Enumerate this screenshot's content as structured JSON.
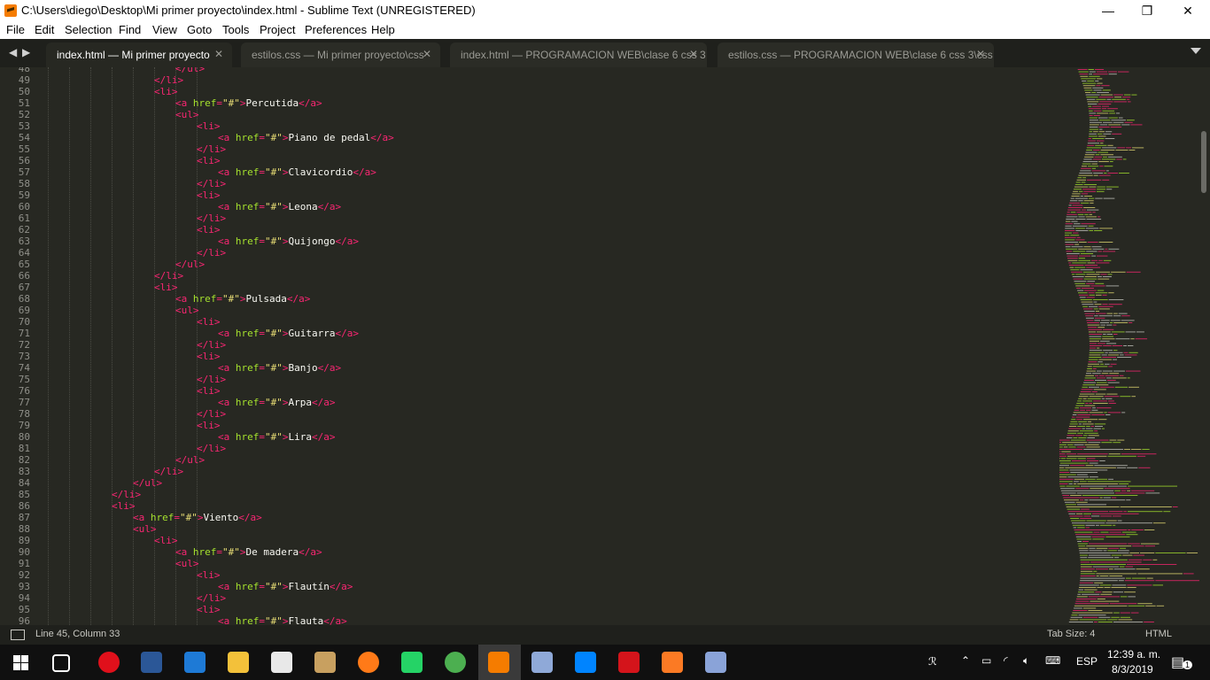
{
  "window": {
    "title": "C:\\Users\\diego\\Desktop\\Mi primer proyecto\\index.html - Sublime Text (UNREGISTERED)",
    "minimize": "—",
    "maximize": "❐",
    "close": "✕"
  },
  "menu": [
    "File",
    "Edit",
    "Selection",
    "Find",
    "View",
    "Goto",
    "Tools",
    "Project",
    "Preferences",
    "Help"
  ],
  "tabs": [
    {
      "label": "index.html — Mi primer proyecto",
      "active": true
    },
    {
      "label": "estilos.css — Mi primer proyecto\\css",
      "active": false
    },
    {
      "label": "index.html — PROGRAMACION  WEB\\clase 6 css 3",
      "active": false
    },
    {
      "label": "estilos.css — PROGRAMACION  WEB\\clase 6 css 3\\css",
      "active": false
    }
  ],
  "tab_close": "✕",
  "nav": {
    "back": "◀",
    "forward": "▶"
  },
  "editor": {
    "lines": [
      {
        "n": 48,
        "i": 6,
        "t": [
          [
            "tag",
            "</ul>"
          ]
        ]
      },
      {
        "n": 49,
        "i": 5,
        "t": [
          [
            "tag",
            "</li>"
          ]
        ]
      },
      {
        "n": 50,
        "i": 5,
        "t": [
          [
            "tag",
            "<li>"
          ]
        ]
      },
      {
        "n": 51,
        "i": 6,
        "t": [
          [
            "tag",
            "<a "
          ],
          [
            "attr",
            "href"
          ],
          [
            "tag",
            "="
          ],
          [
            "str",
            "\"#\""
          ],
          [
            "tag",
            ">"
          ],
          [
            "txt",
            "Percutida"
          ],
          [
            "tag",
            "</a>"
          ]
        ]
      },
      {
        "n": 52,
        "i": 6,
        "t": [
          [
            "tag",
            "<ul>"
          ]
        ]
      },
      {
        "n": 53,
        "i": 7,
        "t": [
          [
            "tag",
            "<li>"
          ]
        ]
      },
      {
        "n": 54,
        "i": 8,
        "t": [
          [
            "tag",
            "<a "
          ],
          [
            "attr",
            "href"
          ],
          [
            "tag",
            "="
          ],
          [
            "str",
            "\"#\""
          ],
          [
            "tag",
            ">"
          ],
          [
            "txt",
            "Piano de pedal"
          ],
          [
            "tag",
            "</a>"
          ]
        ]
      },
      {
        "n": 55,
        "i": 7,
        "t": [
          [
            "tag",
            "</li>"
          ]
        ]
      },
      {
        "n": 56,
        "i": 7,
        "t": [
          [
            "tag",
            "<li>"
          ]
        ]
      },
      {
        "n": 57,
        "i": 8,
        "t": [
          [
            "tag",
            "<a "
          ],
          [
            "attr",
            "href"
          ],
          [
            "tag",
            "="
          ],
          [
            "str",
            "\"#\""
          ],
          [
            "tag",
            ">"
          ],
          [
            "txt",
            "Clavicordio"
          ],
          [
            "tag",
            "</a>"
          ]
        ]
      },
      {
        "n": 58,
        "i": 7,
        "t": [
          [
            "tag",
            "</li>"
          ]
        ]
      },
      {
        "n": 59,
        "i": 7,
        "t": [
          [
            "tag",
            "<li>"
          ]
        ]
      },
      {
        "n": 60,
        "i": 8,
        "t": [
          [
            "tag",
            "<a "
          ],
          [
            "attr",
            "href"
          ],
          [
            "tag",
            "="
          ],
          [
            "str",
            "\"#\""
          ],
          [
            "tag",
            ">"
          ],
          [
            "txt",
            "Leona"
          ],
          [
            "tag",
            "</a>"
          ]
        ]
      },
      {
        "n": 61,
        "i": 7,
        "t": [
          [
            "tag",
            "</li>"
          ]
        ]
      },
      {
        "n": 62,
        "i": 7,
        "t": [
          [
            "tag",
            "<li>"
          ]
        ]
      },
      {
        "n": 63,
        "i": 8,
        "t": [
          [
            "tag",
            "<a "
          ],
          [
            "attr",
            "href"
          ],
          [
            "tag",
            "="
          ],
          [
            "str",
            "\"#\""
          ],
          [
            "tag",
            ">"
          ],
          [
            "txt",
            "Quijongo"
          ],
          [
            "tag",
            "</a>"
          ]
        ]
      },
      {
        "n": 64,
        "i": 7,
        "t": [
          [
            "tag",
            "</li>"
          ]
        ]
      },
      {
        "n": 65,
        "i": 6,
        "t": [
          [
            "tag",
            "</ul>"
          ]
        ]
      },
      {
        "n": 66,
        "i": 5,
        "t": [
          [
            "tag",
            "</li>"
          ]
        ]
      },
      {
        "n": 67,
        "i": 5,
        "t": [
          [
            "tag",
            "<li>"
          ]
        ]
      },
      {
        "n": 68,
        "i": 6,
        "t": [
          [
            "tag",
            "<a "
          ],
          [
            "attr",
            "href"
          ],
          [
            "tag",
            "="
          ],
          [
            "str",
            "\"#\""
          ],
          [
            "tag",
            ">"
          ],
          [
            "txt",
            "Pulsada"
          ],
          [
            "tag",
            "</a>"
          ]
        ]
      },
      {
        "n": 69,
        "i": 6,
        "t": [
          [
            "tag",
            "<ul>"
          ]
        ]
      },
      {
        "n": 70,
        "i": 7,
        "t": [
          [
            "tag",
            "<li>"
          ]
        ]
      },
      {
        "n": 71,
        "i": 8,
        "t": [
          [
            "tag",
            "<a "
          ],
          [
            "attr",
            "href"
          ],
          [
            "tag",
            "="
          ],
          [
            "str",
            "\"#\""
          ],
          [
            "tag",
            ">"
          ],
          [
            "txt",
            "Guitarra"
          ],
          [
            "tag",
            "</a>"
          ]
        ]
      },
      {
        "n": 72,
        "i": 7,
        "t": [
          [
            "tag",
            "</li>"
          ]
        ]
      },
      {
        "n": 73,
        "i": 7,
        "t": [
          [
            "tag",
            "<li>"
          ]
        ]
      },
      {
        "n": 74,
        "i": 8,
        "t": [
          [
            "tag",
            "<a "
          ],
          [
            "attr",
            "href"
          ],
          [
            "tag",
            "="
          ],
          [
            "str",
            "\"#\""
          ],
          [
            "tag",
            ">"
          ],
          [
            "txt",
            "Banjo"
          ],
          [
            "tag",
            "</a>"
          ]
        ]
      },
      {
        "n": 75,
        "i": 7,
        "t": [
          [
            "tag",
            "</li>"
          ]
        ]
      },
      {
        "n": 76,
        "i": 7,
        "t": [
          [
            "tag",
            "<li>"
          ]
        ]
      },
      {
        "n": 77,
        "i": 8,
        "t": [
          [
            "tag",
            "<a "
          ],
          [
            "attr",
            "href"
          ],
          [
            "tag",
            "="
          ],
          [
            "str",
            "\"#\""
          ],
          [
            "tag",
            ">"
          ],
          [
            "txt",
            "Arpa"
          ],
          [
            "tag",
            "</a>"
          ]
        ]
      },
      {
        "n": 78,
        "i": 7,
        "t": [
          [
            "tag",
            "</li>"
          ]
        ]
      },
      {
        "n": 79,
        "i": 7,
        "t": [
          [
            "tag",
            "<li>"
          ]
        ]
      },
      {
        "n": 80,
        "i": 8,
        "t": [
          [
            "tag",
            "<a "
          ],
          [
            "attr",
            "href"
          ],
          [
            "tag",
            "="
          ],
          [
            "str",
            "\"#\""
          ],
          [
            "tag",
            ">"
          ],
          [
            "txt",
            "Lira"
          ],
          [
            "tag",
            "</a>"
          ]
        ]
      },
      {
        "n": 81,
        "i": 7,
        "t": [
          [
            "tag",
            "</li>"
          ]
        ]
      },
      {
        "n": 82,
        "i": 6,
        "t": [
          [
            "tag",
            "</ul>"
          ]
        ]
      },
      {
        "n": 83,
        "i": 5,
        "t": [
          [
            "tag",
            "</li>"
          ]
        ]
      },
      {
        "n": 84,
        "i": 4,
        "t": [
          [
            "tag",
            "</ul>"
          ]
        ]
      },
      {
        "n": 85,
        "i": 3,
        "t": [
          [
            "tag",
            "</li>"
          ]
        ]
      },
      {
        "n": 86,
        "i": 3,
        "t": [
          [
            "tag",
            "<li>"
          ]
        ]
      },
      {
        "n": 87,
        "i": 4,
        "t": [
          [
            "tag",
            "<a "
          ],
          [
            "attr",
            "href"
          ],
          [
            "tag",
            "="
          ],
          [
            "str",
            "\"#\""
          ],
          [
            "tag",
            ">"
          ],
          [
            "txt",
            "Viento"
          ],
          [
            "tag",
            "</a>"
          ]
        ]
      },
      {
        "n": 88,
        "i": 4,
        "t": [
          [
            "tag",
            "<ul>"
          ]
        ]
      },
      {
        "n": 89,
        "i": 5,
        "t": [
          [
            "tag",
            "<li>"
          ]
        ]
      },
      {
        "n": 90,
        "i": 6,
        "t": [
          [
            "tag",
            "<a "
          ],
          [
            "attr",
            "href"
          ],
          [
            "tag",
            "="
          ],
          [
            "str",
            "\"#\""
          ],
          [
            "tag",
            ">"
          ],
          [
            "txt",
            "De madera"
          ],
          [
            "tag",
            "</a>"
          ]
        ]
      },
      {
        "n": 91,
        "i": 6,
        "t": [
          [
            "tag",
            "<ul>"
          ]
        ]
      },
      {
        "n": 92,
        "i": 7,
        "t": [
          [
            "tag",
            "<li>"
          ]
        ]
      },
      {
        "n": 93,
        "i": 8,
        "t": [
          [
            "tag",
            "<a "
          ],
          [
            "attr",
            "href"
          ],
          [
            "tag",
            "="
          ],
          [
            "str",
            "\"#\""
          ],
          [
            "tag",
            ">"
          ],
          [
            "txt",
            "Flautín"
          ],
          [
            "tag",
            "</a>"
          ]
        ]
      },
      {
        "n": 94,
        "i": 7,
        "t": [
          [
            "tag",
            "</li>"
          ]
        ]
      },
      {
        "n": 95,
        "i": 7,
        "t": [
          [
            "tag",
            "<li>"
          ]
        ]
      },
      {
        "n": 96,
        "i": 8,
        "t": [
          [
            "tag",
            "<a "
          ],
          [
            "attr",
            "href"
          ],
          [
            "tag",
            "="
          ],
          [
            "str",
            "\"#\""
          ],
          [
            "tag",
            ">"
          ],
          [
            "txt",
            "Flauta"
          ],
          [
            "tag",
            "</a>"
          ]
        ]
      }
    ]
  },
  "status": {
    "position": "Line 45, Column 33",
    "tab_size": "Tab Size: 4",
    "syntax": "HTML"
  },
  "taskbar": {
    "apps": [
      {
        "name": "task-view-icon",
        "color": "#ffffff"
      },
      {
        "name": "opera-icon",
        "color": "#e0101b"
      },
      {
        "name": "word-icon",
        "color": "#2b5797"
      },
      {
        "name": "edge-icon",
        "color": "#1e7ad6"
      },
      {
        "name": "file-explorer-icon",
        "color": "#f3c13a"
      },
      {
        "name": "mail-icon",
        "color": "#e8e8e8"
      },
      {
        "name": "paint-icon",
        "color": "#c8a060"
      },
      {
        "name": "firefox-icon",
        "color": "#ff7a18"
      },
      {
        "name": "whatsapp-icon",
        "color": "#25d366"
      },
      {
        "name": "chrome-icon",
        "color": "#4caf50"
      },
      {
        "name": "sublime-text-icon",
        "color": "#f57c00"
      },
      {
        "name": "notepad-icon",
        "color": "#8fa9d8"
      },
      {
        "name": "messenger-icon",
        "color": "#0084ff"
      },
      {
        "name": "acrobat-icon",
        "color": "#d4141b"
      },
      {
        "name": "xampp-icon",
        "color": "#fb7a24"
      },
      {
        "name": "hwp-icon",
        "color": "#8aa3d8"
      }
    ],
    "language": "ESP",
    "time": "12:39 a. m.",
    "date": "8/3/2019",
    "notifications": "1"
  },
  "colors": {
    "editor_bg": "#272822",
    "tag": "#f92672",
    "attr": "#a6e22e",
    "string": "#e6db74",
    "text": "#f8f8f2"
  }
}
